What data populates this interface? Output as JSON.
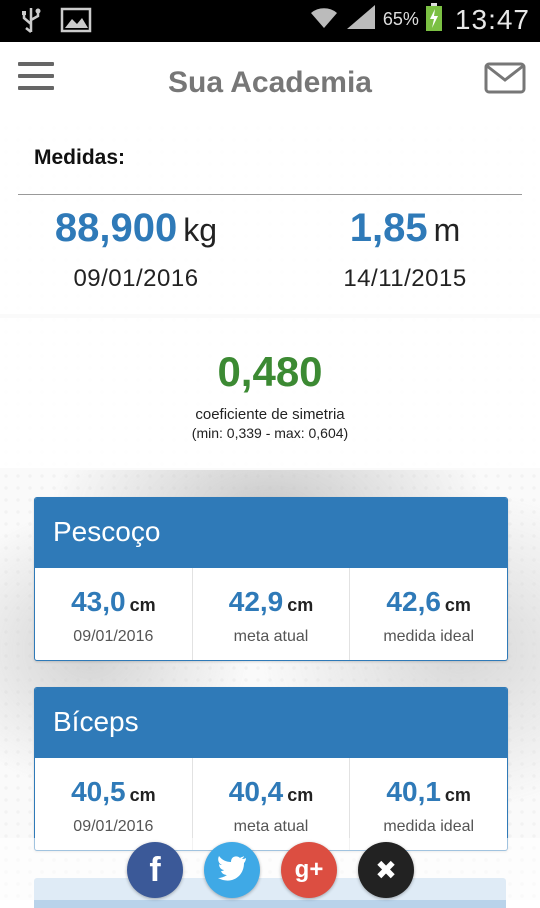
{
  "status_bar": {
    "battery": "65%",
    "time": "13:47"
  },
  "header": {
    "title": "Sua Academia"
  },
  "medidas": {
    "label": "Medidas:",
    "weight": {
      "value": "88,900",
      "unit": "kg",
      "date": "09/01/2016"
    },
    "height": {
      "value": "1,85",
      "unit": "m",
      "date": "14/11/2015"
    }
  },
  "symmetry": {
    "value": "0,480",
    "label": "coeficiente de simetria",
    "range": "(min: 0,339 - max: 0,604)"
  },
  "cards": [
    {
      "title": "Pescoço",
      "cells": [
        {
          "value": "43,0",
          "unit": "cm",
          "sub": "09/01/2016"
        },
        {
          "value": "42,9",
          "unit": "cm",
          "sub": "meta atual"
        },
        {
          "value": "42,6",
          "unit": "cm",
          "sub": "medida ideal"
        }
      ]
    },
    {
      "title": "Bíceps",
      "cells": [
        {
          "value": "40,5",
          "unit": "cm",
          "sub": "09/01/2016"
        },
        {
          "value": "40,4",
          "unit": "cm",
          "sub": "meta atual"
        },
        {
          "value": "40,1",
          "unit": "cm",
          "sub": "medida ideal"
        }
      ]
    }
  ],
  "share": {
    "facebook": {
      "glyph": "f",
      "color": "#3b5998"
    },
    "twitter": {
      "color": "#3fa9e6"
    },
    "googleplus": {
      "glyph": "g+",
      "color": "#dc4e41"
    },
    "close": {
      "glyph": "✖",
      "color": "#222222"
    }
  }
}
